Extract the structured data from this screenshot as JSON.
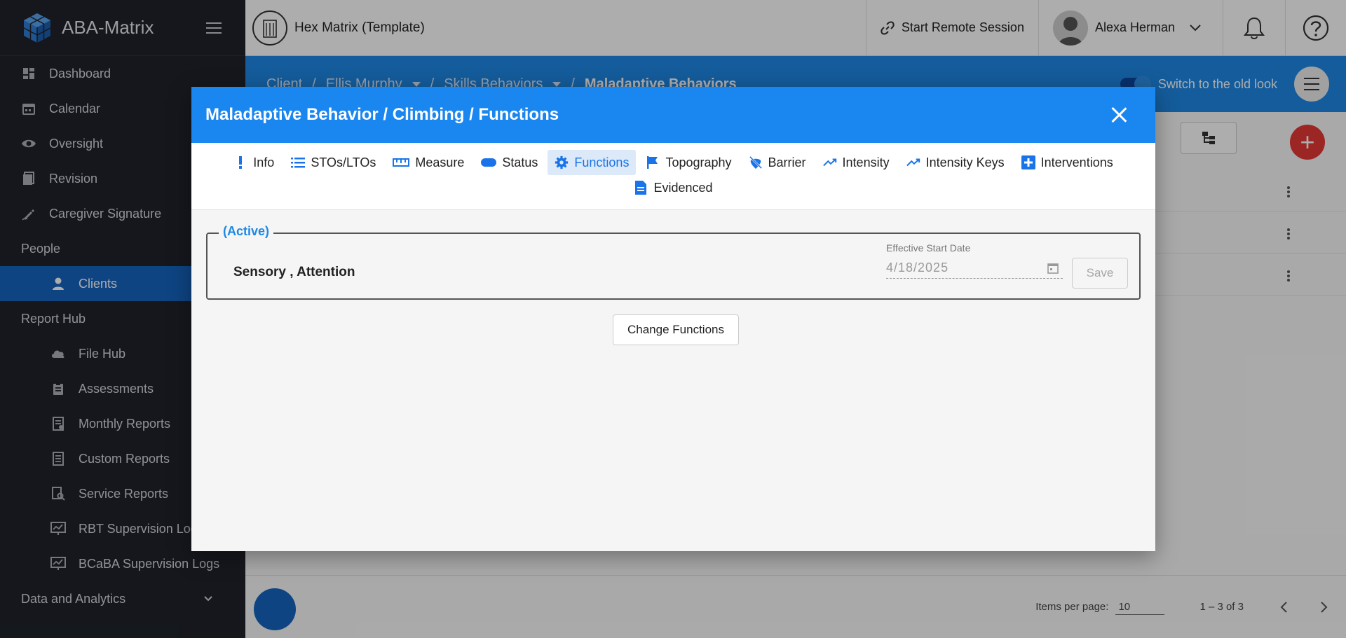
{
  "sidebar": {
    "brand": "ABA-Matrix",
    "items": [
      {
        "label": "Dashboard",
        "icon": "dashboard-icon"
      },
      {
        "label": "Calendar",
        "icon": "calendar-icon"
      },
      {
        "label": "Oversight",
        "icon": "eye-icon"
      },
      {
        "label": "Revision",
        "icon": "revision-icon"
      },
      {
        "label": "Caregiver Signature",
        "icon": "signature-pen-icon"
      }
    ],
    "people_section": "People",
    "clients": "Clients",
    "report_section": "Report Hub",
    "reports": [
      {
        "label": "File Hub",
        "icon": "cloud-icon"
      },
      {
        "label": "Assessments",
        "icon": "clipboard-icon"
      },
      {
        "label": "Monthly Reports",
        "icon": "report-icon"
      },
      {
        "label": "Custom Reports",
        "icon": "doc-icon"
      },
      {
        "label": "Service Reports",
        "icon": "report-search-icon"
      },
      {
        "label": "RBT Supervision Logs",
        "icon": "chart-monitor-icon"
      },
      {
        "label": "BCaBA Supervision Logs",
        "icon": "chart-monitor-icon"
      }
    ],
    "data_section": "Data and Analytics"
  },
  "topbar": {
    "org_name": "Hex Matrix (Template)",
    "remote_session": "Start Remote Session",
    "user_name": "Alexa Herman"
  },
  "breadcrumb": {
    "root": "Client",
    "client": "Ellis Murphy",
    "section": "Skills Behaviors",
    "current": "Maladaptive Behaviors",
    "toggle_label": "Switch to the old look"
  },
  "pager": {
    "items_per_page_label": "Items per page:",
    "items_per_page": "10",
    "range": "1 – 3 of 3"
  },
  "dialog": {
    "title": "Maladaptive Behavior / Climbing / Functions",
    "tabs": [
      "Info",
      "STOs/LTOs",
      "Measure",
      "Status",
      "Functions",
      "Topography",
      "Barrier",
      "Intensity",
      "Intensity Keys",
      "Interventions",
      "Evidenced"
    ],
    "active_tab": "Functions",
    "status_legend": "(Active)",
    "functions_text": "Sensory , Attention",
    "date_label": "Effective Start Date",
    "date_value": "4/18/2025",
    "save_label": "Save",
    "change_label": "Change Functions"
  },
  "colors": {
    "primary": "#1a86f0",
    "sidebar_bg": "#1f232b",
    "active_nav": "#1565c0",
    "fab": "#e53935"
  }
}
